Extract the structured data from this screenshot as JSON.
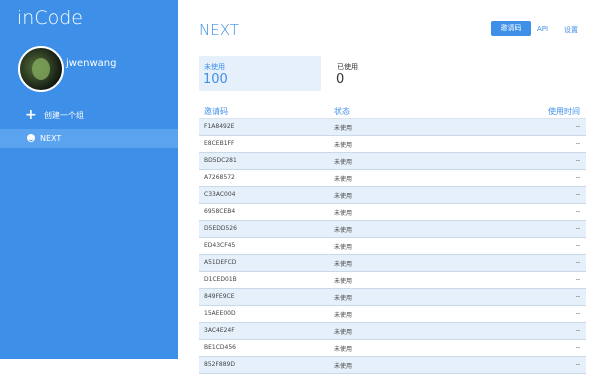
{
  "sidebar": {
    "brand": "inCode",
    "username": "jwenwang",
    "create_label": "创建一个组",
    "active_item": "NEXT"
  },
  "header": {
    "title": "NEXT",
    "invite_button": "邀请码",
    "api_link": "API",
    "settings_link": "设置"
  },
  "stats": {
    "unused_label": "未使用",
    "unused_value": "100",
    "used_label": "已使用",
    "used_value": "0"
  },
  "table": {
    "headers": [
      "邀请码",
      "状态",
      "使用时间"
    ],
    "rows": [
      [
        "F1A8492E",
        "未使用",
        "--"
      ],
      [
        "E8CEB1FF",
        "未使用",
        "--"
      ],
      [
        "BD5DC281",
        "未使用",
        "--"
      ],
      [
        "A7268572",
        "未使用",
        "--"
      ],
      [
        "C33AC004",
        "未使用",
        "--"
      ],
      [
        "6958CEB4",
        "未使用",
        "--"
      ],
      [
        "D5EDD526",
        "未使用",
        "--"
      ],
      [
        "ED43CF45",
        "未使用",
        "--"
      ],
      [
        "A51DEFCD",
        "未使用",
        "--"
      ],
      [
        "D1CED01B",
        "未使用",
        "--"
      ],
      [
        "849FE9CE",
        "未使用",
        "--"
      ],
      [
        "15AEE00D",
        "未使用",
        "--"
      ],
      [
        "3AC4E24F",
        "未使用",
        "--"
      ],
      [
        "BE1CD456",
        "未使用",
        "--"
      ],
      [
        "852F889D",
        "未使用",
        "--"
      ]
    ]
  },
  "colors": {
    "accent": "#3d8fe8",
    "row_alt": "#e6f0fb"
  }
}
